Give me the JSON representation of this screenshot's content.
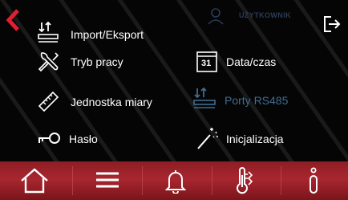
{
  "header": {
    "user_label": "UŻYTKOWNIK"
  },
  "menu": {
    "import_export": "Import/Eksport",
    "work_mode": "Tryb pracy",
    "date_time": "Data/czas",
    "date_icon_day": "31",
    "units": "Jednostka miary",
    "ports_rs485": "Porty RS485",
    "password": "Hasło",
    "initialization": "Inicjalizacja"
  },
  "colors": {
    "accent_red": "#e02030",
    "bar_red": "#a8262f",
    "text_white": "#ffffff",
    "disabled_blue": "#3f6d92",
    "user_dim": "#2a3c56"
  },
  "icons": {
    "back": "chevron-left-icon",
    "user": "user-icon",
    "logout": "logout-icon",
    "import_export": "import-export-icon",
    "work_mode": "wrench-screwdriver-icon",
    "date_time": "calendar-icon",
    "units": "ruler-icon",
    "ports": "ports-icon",
    "password": "key-icon",
    "initialization": "magic-wand-icon",
    "home": "home-icon",
    "menu": "hamburger-icon",
    "alarm": "bell-icon",
    "temperature": "thermometer-icon",
    "info": "info-icon"
  }
}
